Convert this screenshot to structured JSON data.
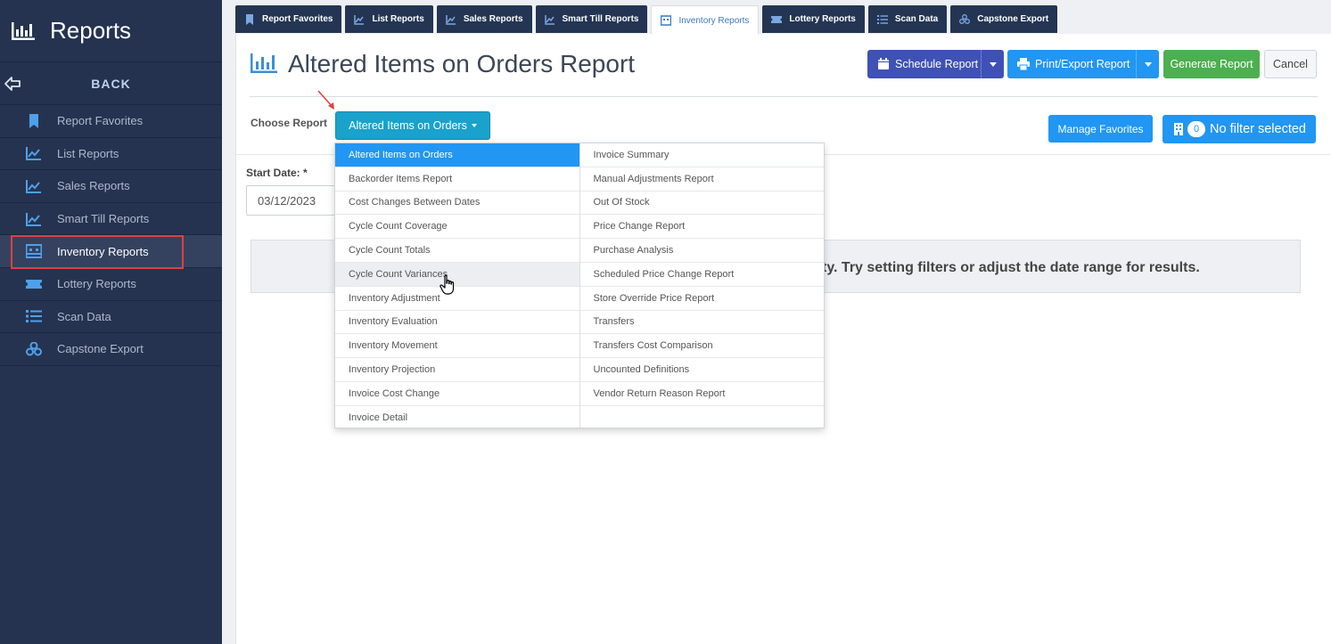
{
  "sidebar": {
    "title": "Reports",
    "back_label": "BACK",
    "items": [
      {
        "label": "Report Favorites",
        "icon": "bookmark-icon"
      },
      {
        "label": "List Reports",
        "icon": "line-chart-icon"
      },
      {
        "label": "Sales Reports",
        "icon": "line-chart-icon"
      },
      {
        "label": "Smart Till Reports",
        "icon": "line-chart-icon"
      },
      {
        "label": "Inventory Reports",
        "icon": "inventory-icon",
        "active": true
      },
      {
        "label": "Lottery Reports",
        "icon": "ticket-icon"
      },
      {
        "label": "Scan Data",
        "icon": "list-icon"
      },
      {
        "label": "Capstone Export",
        "icon": "boxes-icon"
      }
    ]
  },
  "tabs": [
    {
      "label": "Report Favorites"
    },
    {
      "label": "List Reports"
    },
    {
      "label": "Sales Reports"
    },
    {
      "label": "Smart Till Reports"
    },
    {
      "label": "Inventory Reports",
      "active": true
    },
    {
      "label": "Lottery Reports"
    },
    {
      "label": "Scan Data"
    },
    {
      "label": "Capstone Export"
    }
  ],
  "header": {
    "title": "Altered Items on Orders Report",
    "schedule_label": "Schedule Report",
    "print_label": "Print/Export Report",
    "generate_label": "Generate Report",
    "cancel_label": "Cancel"
  },
  "choose": {
    "label": "Choose Report",
    "selected": "Altered Items on Orders"
  },
  "manage_favorites_label": "Manage Favorites",
  "filter": {
    "count": "0",
    "label": "No filter selected"
  },
  "start_date": {
    "label": "Start Date: *",
    "value": "03/12/2023"
  },
  "empty_message": "ty. Try setting filters or adjust the date range for results.",
  "dropdown": {
    "left": [
      "Altered Items on Orders",
      "Backorder Items Report",
      "Cost Changes Between Dates",
      "Cycle Count Coverage",
      "Cycle Count Totals",
      "Cycle Count Variances",
      "Inventory Adjustment",
      "Inventory Evaluation",
      "Inventory Movement",
      "Inventory Projection",
      "Invoice Cost Change",
      "Invoice Detail"
    ],
    "right": [
      "Invoice Summary",
      "Manual Adjustments Report",
      "Out Of Stock",
      "Price Change Report",
      "Purchase Analysis",
      "Scheduled Price Change Report",
      "Store Override Price Report",
      "Transfers",
      "Transfers Cost Comparison",
      "Uncounted Definitions",
      "Vendor Return Reason Report",
      ""
    ]
  },
  "colors": {
    "sidebar_bg": "#253350",
    "accent_blue": "#2196f3",
    "schedule_indigo": "#3f51b5",
    "generate_green": "#4caf50",
    "choose_teal": "#1aa1cc",
    "highlight_red": "#e04040"
  }
}
